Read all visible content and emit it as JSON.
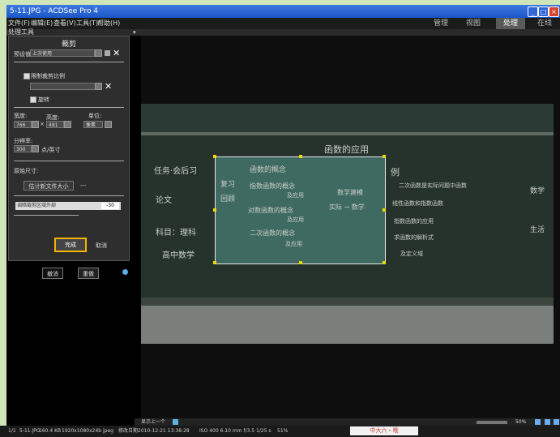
{
  "window": {
    "title": "5-11.JPG - ACDSee Pro 4",
    "controls": {
      "minimize": "_",
      "maximize": "□",
      "close": "×"
    }
  },
  "menu": [
    "文件(F)",
    "编辑(E)",
    "查看(V)",
    "工具(T)",
    "帮助(H)"
  ],
  "modes": [
    "管理",
    "视图",
    "处理",
    "在线"
  ],
  "active_mode": "处理",
  "left_panel": {
    "section_title": "处理工具",
    "crop_title": "裁剪",
    "preset_label": "预设值",
    "preset_value": "上次使用",
    "limit_ratio_label": "限制裁剪比例",
    "rotate_label": "旋转",
    "width_label": "宽度:",
    "height_label": "高度:",
    "unit_label": "单位:",
    "width_value": "766",
    "height_value": "481",
    "unit_value": "像素",
    "resolution_label": "分辨率:",
    "resolution_value": "300",
    "resolution_unit": "点/英寸",
    "original_size_label": "原始尺寸:",
    "estimate_label": "估计新文件大小",
    "estimate_value": "---",
    "slider_label": "调暗裁剪区域外部",
    "slider_value": "-30",
    "done_button": "完成",
    "cancel_button": "取消",
    "bottom_btn_1": "撤消",
    "bottom_btn_2": "重做"
  },
  "chalkboard": {
    "heading": "函数的应用",
    "left_texts": [
      "任务·会后习",
      "论文",
      "科目：理科",
      "高中数学"
    ],
    "crop_texts": [
      "复习",
      "回顾",
      "函数的概念",
      "指数函数的概念",
      "及应用",
      "对数函数的概念",
      "及应用",
      "二次函数的概念",
      "及应用",
      "数学建模",
      "实际 → 数学"
    ],
    "right_texts": [
      "例",
      "二次函数是实际问题中函数",
      "线性函数和指数函数",
      "指数函数的应用",
      "求函数的解析式",
      "及定义域",
      "数学",
      "生活"
    ]
  },
  "navigation": {
    "label": "显示上一个"
  },
  "ime_text": "中大六・哦",
  "zoom": "50%",
  "status": {
    "index": "1/1",
    "filename": "5-11.JPG",
    "filesize": "160.4 KB",
    "dimensions": "1920x1080x24b jpeg",
    "modified_label": "修改日期",
    "date": "2010-12-21 13:38:28",
    "camera": "ISO 400  6.10 mm  f/3.5  1/25 s",
    "zoom": "51%"
  },
  "colors": {
    "titlebar": "#1a56c8",
    "highlight": "#f4b400",
    "crop_handle": "#f2d600"
  }
}
